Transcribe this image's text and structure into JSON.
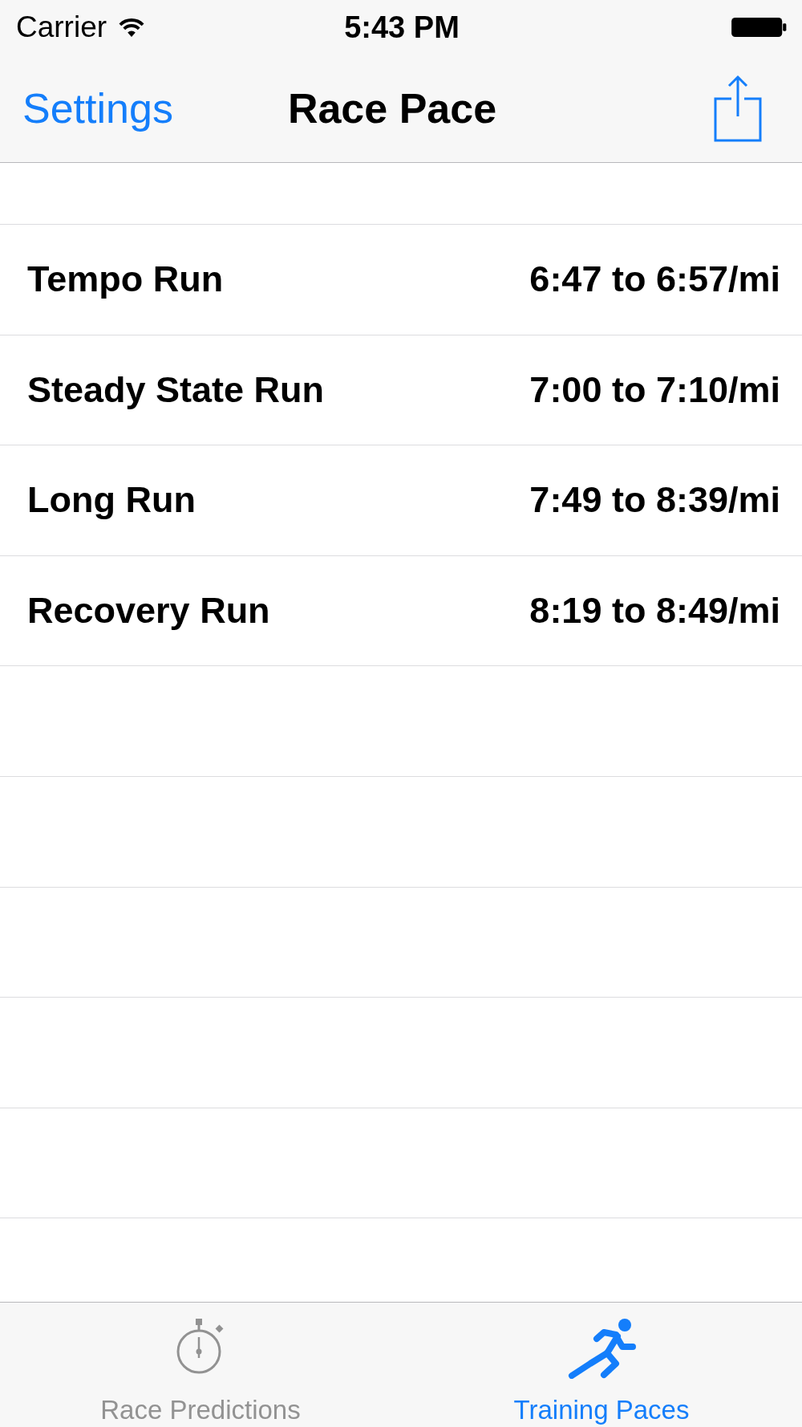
{
  "status_bar": {
    "carrier": "Carrier",
    "time": "5:43 PM"
  },
  "nav_bar": {
    "back_button": "Settings",
    "title": "Race Pace"
  },
  "paces": [
    {
      "name": "Tempo Run",
      "range": "6:47 to 6:57/mi"
    },
    {
      "name": "Steady State Run",
      "range": "7:00 to 7:10/mi"
    },
    {
      "name": "Long Run",
      "range": "7:49 to 8:39/mi"
    },
    {
      "name": "Recovery Run",
      "range": "8:19 to 8:49/mi"
    }
  ],
  "tab_bar": {
    "tabs": [
      {
        "label": "Race Predictions",
        "selected": false
      },
      {
        "label": "Training Paces",
        "selected": true
      }
    ]
  }
}
